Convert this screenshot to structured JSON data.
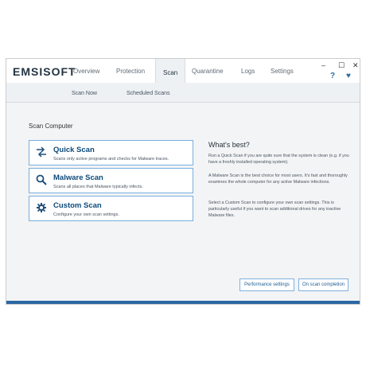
{
  "brand": {
    "logo": "EMSISOFT",
    "accent": "#2c67a3",
    "button_border": "#77aee0",
    "text_dark": "#233341"
  },
  "header": {
    "tabs": [
      {
        "label": "Overview"
      },
      {
        "label": "Protection"
      },
      {
        "label": "Scan"
      },
      {
        "label": "Quarantine"
      },
      {
        "label": "Logs"
      },
      {
        "label": "Settings"
      }
    ],
    "active_tab": "Scan",
    "window_controls": {
      "close": "✕",
      "maximize": "☐",
      "minimize": "–"
    },
    "help_label": "?",
    "heart_label": "♥"
  },
  "subnav": {
    "tabs": [
      {
        "label": "Scan Now"
      },
      {
        "label": "Scheduled Scans"
      }
    ]
  },
  "main": {
    "section_title": "Scan Computer",
    "scan_options": [
      {
        "icon": "quick-scan-arrows-icon",
        "label": "Quick Scan",
        "description": "Scans only active programs and checks for Malware traces."
      },
      {
        "icon": "search-icon",
        "label": "Malware Scan",
        "description": "Scans all places that Malware typically infects."
      },
      {
        "icon": "gear-icon",
        "label": "Custom Scan",
        "description": "Configure your own scan settings."
      }
    ]
  },
  "sidebar": {
    "title": "What's best?",
    "paragraphs": [
      "Run a Quick Scan if you are quite sure that the system is clean (e.g. if you have a freshly installed operating system).",
      "A Malware Scan is the best choice for most users. It's fast and thoroughly examines the whole computer for any active Malware infections.",
      "Select a Custom Scan to configure your own scan settings. This is particularly useful if you want to scan additional drives for any inactive Malware files."
    ]
  },
  "actions": {
    "performance_settings": "Performance settings",
    "on_scan_completion": "On scan completion"
  }
}
